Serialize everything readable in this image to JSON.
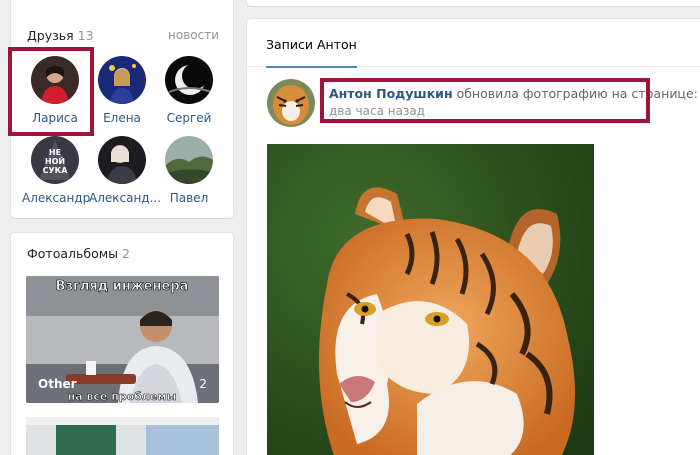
{
  "friends": {
    "title": "Друзья",
    "count": "13",
    "news_link": "новости",
    "items": [
      {
        "name": "Лариса"
      },
      {
        "name": "Елена"
      },
      {
        "name": "Сергей"
      },
      {
        "name": "Александр"
      },
      {
        "name": "Александ..."
      },
      {
        "name": "Павел"
      }
    ],
    "avatar_text": "НЕ НОЙ СУКА"
  },
  "albums": {
    "title": "Фотоальбомы",
    "count": "2",
    "items": [
      {
        "caption": "Other",
        "count": "2",
        "meme_top": "Взгляд инженера",
        "meme_bottom": "на все проблемы"
      }
    ]
  },
  "wall": {
    "tab": "Записи Антон",
    "post": {
      "author": "Антон Подушкин",
      "action": "обновила фотографию на странице:",
      "time": "два часа назад"
    }
  },
  "colors": {
    "highlight": "#a1143a",
    "link": "#2a5885",
    "accent": "#5181b8",
    "background": "#edeef0"
  }
}
